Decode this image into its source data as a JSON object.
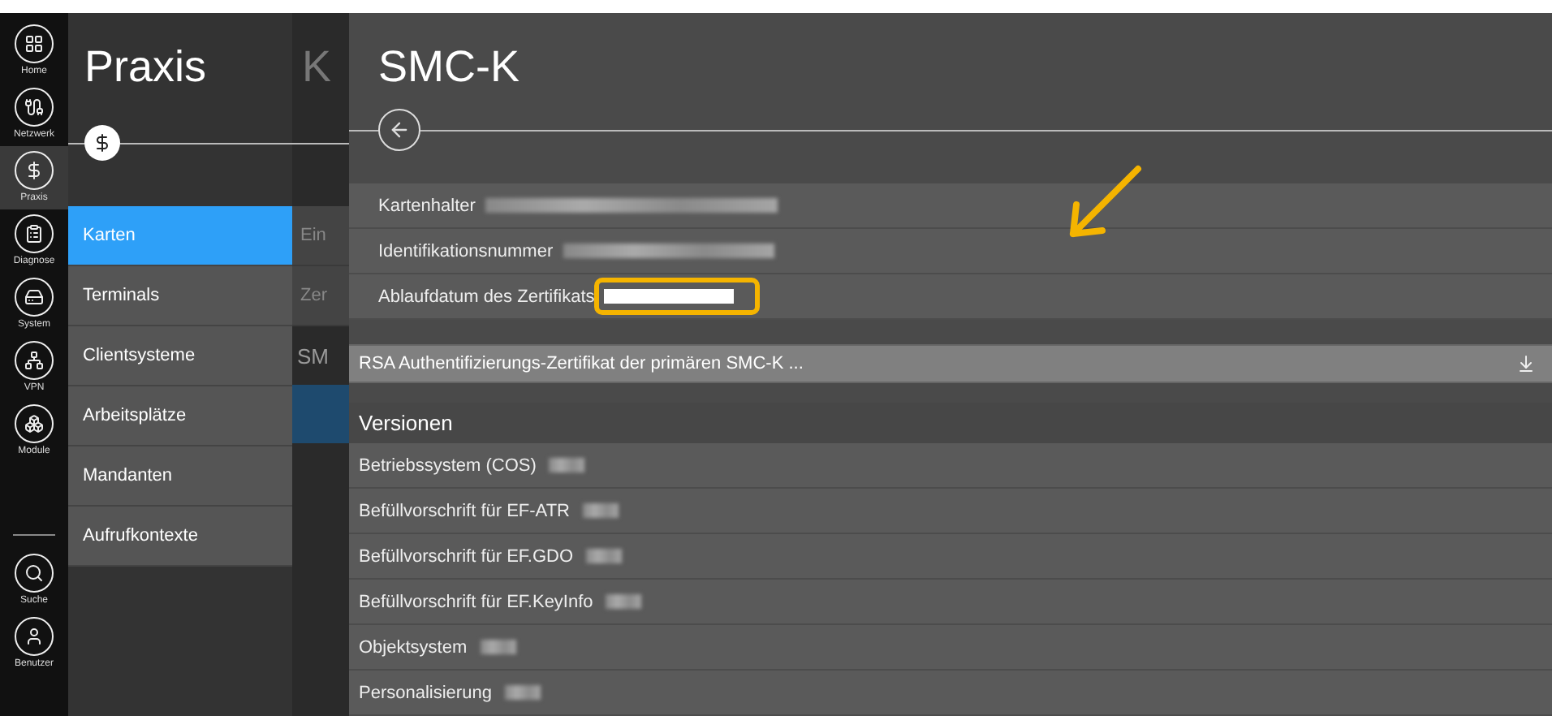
{
  "nav_rail": {
    "items": [
      {
        "label": "Home",
        "selected": false
      },
      {
        "label": "Netzwerk",
        "selected": false
      },
      {
        "label": "Praxis",
        "selected": true
      },
      {
        "label": "Diagnose",
        "selected": false
      },
      {
        "label": "System",
        "selected": false
      },
      {
        "label": "VPN",
        "selected": false
      },
      {
        "label": "Module",
        "selected": false
      }
    ],
    "bottom_items": [
      {
        "label": "Suche"
      },
      {
        "label": "Benutzer"
      }
    ]
  },
  "section_panel": {
    "title": "Praxis",
    "menu": [
      {
        "label": "Karten",
        "selected": true
      },
      {
        "label": "Terminals",
        "selected": false
      },
      {
        "label": "Clientsysteme",
        "selected": false
      },
      {
        "label": "Arbeitsplätze",
        "selected": false
      },
      {
        "label": "Mandanten",
        "selected": false
      },
      {
        "label": "Aufrufkontexte",
        "selected": false
      }
    ]
  },
  "background_panel": {
    "title": "K",
    "items": [
      {
        "label": "Ein"
      },
      {
        "label": "Zer"
      }
    ],
    "group": "SM"
  },
  "detail": {
    "title": "SMC-K",
    "fields": [
      {
        "label": "Kartenhalter",
        "highlighted": false
      },
      {
        "label": "Identifikationsnummer",
        "highlighted": false
      },
      {
        "label": "Ablaufdatum des Zertifikats",
        "highlighted": true
      }
    ],
    "certificate": "RSA Authentifizierungs-Zertifikat der primären SMC-K ...",
    "versions": {
      "heading": "Versionen",
      "rows": [
        {
          "label": "Betriebssystem (COS)"
        },
        {
          "label": "Befüllvorschrift für EF-ATR"
        },
        {
          "label": "Befüllvorschrift für EF.GDO"
        },
        {
          "label": "Befüllvorschrift für EF.KeyInfo"
        },
        {
          "label": "Objektsystem"
        },
        {
          "label": "Personalisierung"
        }
      ]
    }
  }
}
